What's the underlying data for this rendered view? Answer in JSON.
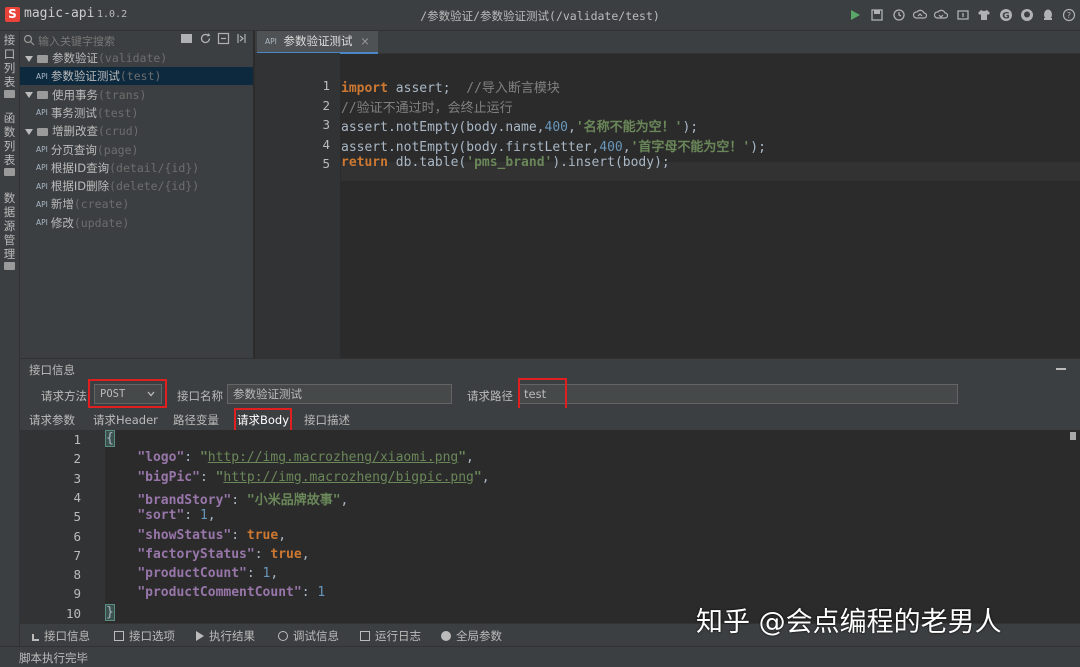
{
  "app": {
    "name": "magic-api",
    "version": "1.0.2",
    "window_title": "/参数验证/参数验证测试(/validate/test)"
  },
  "toolbar_icons": [
    "run-icon",
    "save-icon",
    "history-icon",
    "upload-icon",
    "download-icon",
    "push-icon",
    "skin-icon",
    "gitee-icon",
    "github-icon",
    "qq-icon",
    "help-icon"
  ],
  "left_bar": {
    "items": [
      {
        "label": "接口列表",
        "chars": [
          "接",
          "口",
          "列",
          "表"
        ]
      },
      {
        "label": "函数列表",
        "chars": [
          "函",
          "数",
          "列",
          "表"
        ]
      },
      {
        "label": "数据源管理",
        "chars": [
          "数",
          "据",
          "源",
          "管",
          "理"
        ]
      }
    ]
  },
  "tree": {
    "search_placeholder": "输入关键字搜索",
    "items": [
      {
        "kind": "group",
        "name": "参数验证",
        "path": "(validate)"
      },
      {
        "kind": "api",
        "name": "参数验证测试",
        "path": "(test)",
        "selected": true
      },
      {
        "kind": "group",
        "name": "使用事务",
        "path": "(trans)"
      },
      {
        "kind": "api",
        "name": "事务测试",
        "path": "(test)"
      },
      {
        "kind": "group",
        "name": "增删改查",
        "path": "(crud)"
      },
      {
        "kind": "api",
        "name": "分页查询",
        "path": "(page)"
      },
      {
        "kind": "api",
        "name": "根据ID查询",
        "path": "(detail/{id})"
      },
      {
        "kind": "api",
        "name": "根据ID删除",
        "path": "(delete/{id})"
      },
      {
        "kind": "api",
        "name": "新增",
        "path": "(create)"
      },
      {
        "kind": "api",
        "name": "修改",
        "path": "(update)"
      }
    ]
  },
  "editor": {
    "tab_badge": "API",
    "tab_label": "参数验证测试",
    "lines": [
      {
        "n": "1",
        "tokens": [
          [
            "kw",
            "import"
          ],
          [
            "t",
            " assert;  "
          ],
          [
            "cm",
            "//导入断言模块"
          ]
        ]
      },
      {
        "n": "2",
        "tokens": [
          [
            "cm",
            "//验证不通过时，会终止运行"
          ]
        ]
      },
      {
        "n": "3",
        "tokens": [
          [
            "t",
            "assert.notEmpty(body.name,"
          ],
          [
            "num",
            "400"
          ],
          [
            "t",
            ","
          ],
          [
            "str",
            "'名称不能为空！'"
          ],
          [
            "t",
            ");"
          ]
        ]
      },
      {
        "n": "4",
        "tokens": [
          [
            "t",
            "assert.notEmpty(body.firstLetter,"
          ],
          [
            "num",
            "400"
          ],
          [
            "t",
            ","
          ],
          [
            "str",
            "'首字母不能为空！'"
          ],
          [
            "t",
            ");"
          ]
        ]
      },
      {
        "n": "5",
        "tokens": [
          [
            "kw",
            "return"
          ],
          [
            "t",
            " db.table("
          ],
          [
            "str",
            "'pms_brand'"
          ],
          [
            "t",
            ").insert(body);"
          ]
        ]
      }
    ]
  },
  "panel": {
    "title": "接口信息",
    "method_label": "请求方法",
    "method_value": "POST",
    "name_label": "接口名称",
    "name_value": "参数验证测试",
    "path_label": "请求路径",
    "path_value": "test",
    "tabs": [
      "请求参数",
      "请求Header",
      "路径变量",
      "请求Body",
      "接口描述"
    ],
    "active_tab": "请求Body"
  },
  "body_editor": {
    "lines": [
      {
        "n": "1",
        "tokens": [
          [
            "brace",
            "{"
          ]
        ]
      },
      {
        "n": "2",
        "tokens": [
          [
            "t",
            "    "
          ],
          [
            "key",
            "\"logo\""
          ],
          [
            "t",
            ": "
          ],
          [
            "str",
            "\""
          ],
          [
            "url",
            "http://img.macrozheng/xiaomi.png"
          ],
          [
            "str",
            "\""
          ],
          [
            "t",
            ","
          ]
        ]
      },
      {
        "n": "3",
        "tokens": [
          [
            "t",
            "    "
          ],
          [
            "key",
            "\"bigPic\""
          ],
          [
            "t",
            ": "
          ],
          [
            "str",
            "\""
          ],
          [
            "url",
            "http://img.macrozheng/bigpic.png"
          ],
          [
            "str",
            "\""
          ],
          [
            "t",
            ","
          ]
        ]
      },
      {
        "n": "4",
        "tokens": [
          [
            "t",
            "    "
          ],
          [
            "key",
            "\"brandStory\""
          ],
          [
            "t",
            ": "
          ],
          [
            "str",
            "\"小米品牌故事\""
          ],
          [
            "t",
            ","
          ]
        ]
      },
      {
        "n": "5",
        "tokens": [
          [
            "t",
            "    "
          ],
          [
            "key",
            "\"sort\""
          ],
          [
            "t",
            ": "
          ],
          [
            "num",
            "1"
          ],
          [
            "t",
            ","
          ]
        ]
      },
      {
        "n": "6",
        "tokens": [
          [
            "t",
            "    "
          ],
          [
            "key",
            "\"showStatus\""
          ],
          [
            "t",
            ": "
          ],
          [
            "kwb",
            "true"
          ],
          [
            "t",
            ","
          ]
        ]
      },
      {
        "n": "7",
        "tokens": [
          [
            "t",
            "    "
          ],
          [
            "key",
            "\"factoryStatus\""
          ],
          [
            "t",
            ": "
          ],
          [
            "kwb",
            "true"
          ],
          [
            "t",
            ","
          ]
        ]
      },
      {
        "n": "8",
        "tokens": [
          [
            "t",
            "    "
          ],
          [
            "key",
            "\"productCount\""
          ],
          [
            "t",
            ": "
          ],
          [
            "num",
            "1"
          ],
          [
            "t",
            ","
          ]
        ]
      },
      {
        "n": "9",
        "tokens": [
          [
            "t",
            "    "
          ],
          [
            "key",
            "\"productCommentCount\""
          ],
          [
            "t",
            ": "
          ],
          [
            "num",
            "1"
          ]
        ]
      },
      {
        "n": "10",
        "tokens": [
          [
            "brace",
            "}"
          ]
        ]
      }
    ]
  },
  "tool_tabs": [
    {
      "label": "接口信息",
      "icon": "info-icon"
    },
    {
      "label": "接口选项",
      "icon": "grid-icon"
    },
    {
      "label": "执行结果",
      "icon": "play-icon"
    },
    {
      "label": "调试信息",
      "icon": "bug-icon"
    },
    {
      "label": "运行日志",
      "icon": "log-icon"
    },
    {
      "label": "全局参数",
      "icon": "settings-icon"
    }
  ],
  "status": "脚本执行完毕",
  "watermark": "知乎 @会点编程的老男人"
}
